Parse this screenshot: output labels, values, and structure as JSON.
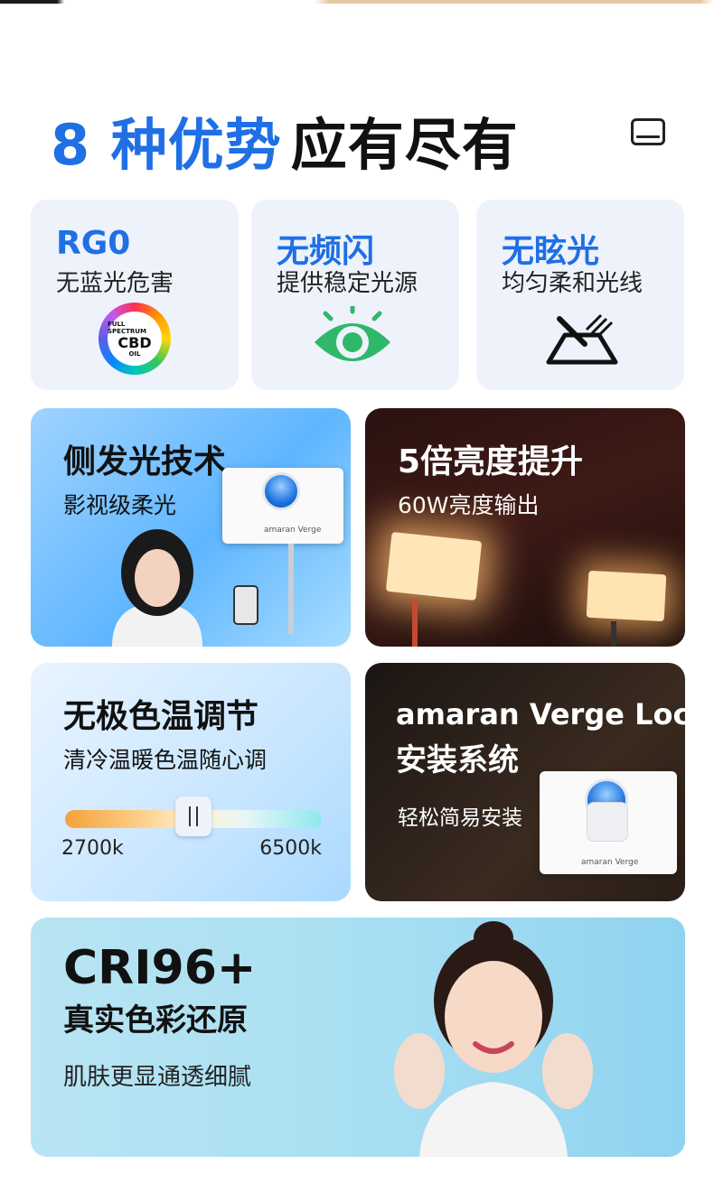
{
  "headline": {
    "accent": "8 种优势",
    "rest": "应有尽有"
  },
  "features_small": [
    {
      "title": "RG0",
      "subtitle": "无蓝光危害",
      "icon": "full-spectrum-cbd-icon",
      "icon_text_top": "FULL SPECTRUM",
      "icon_text_main": "CBD",
      "icon_text_bottom": "OIL"
    },
    {
      "title": "无频闪",
      "subtitle": "提供稳定光源",
      "icon": "eye-icon"
    },
    {
      "title": "无眩光",
      "subtitle": "均匀柔和光线",
      "icon": "glare-free-icon"
    }
  ],
  "side_light": {
    "title": "侧发光技术",
    "subtitle": "影视级柔光",
    "device_brand": "amaran  Verge"
  },
  "brightness": {
    "title": "5倍亮度提升",
    "subtitle": "60W亮度输出"
  },
  "color_temp": {
    "title": "无极色温调节",
    "subtitle": "清冷温暖色温随心调",
    "min_label": "2700k",
    "max_label": "6500k",
    "knob_position": 0.5
  },
  "mount": {
    "title_line1": "amaran Verge Lock",
    "title_line2": "安装系统",
    "subtitle": "轻松简易安装",
    "device_brand": "amaran  Verge"
  },
  "cri": {
    "title_line1": "CRI96+",
    "title_line2": "真实色彩还原",
    "subtitle": "肌肤更显通透细腻"
  },
  "colors": {
    "accent_blue": "#1f6fe5",
    "card_bg": "#eef2fb",
    "eye_green": "#2fb86a"
  }
}
